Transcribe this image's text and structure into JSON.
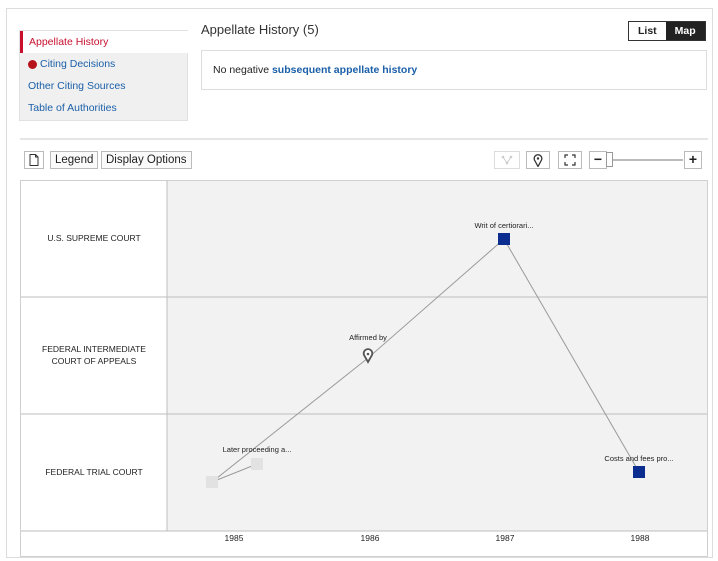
{
  "nav": {
    "items": [
      {
        "label": "Appellate History",
        "active": true
      },
      {
        "label": "Citing Decisions",
        "flag": "red"
      },
      {
        "label": "Other Citing Sources"
      },
      {
        "label": "Table of Authorities"
      }
    ]
  },
  "header": {
    "title": "Appellate History (5)",
    "view_list": "List",
    "view_map": "Map"
  },
  "message": {
    "prefix": "No negative ",
    "link": "subsequent appellate history"
  },
  "toolbar": {
    "legend": "Legend",
    "display_options": "Display Options",
    "zoom_minus": "−",
    "zoom_plus": "+"
  },
  "map": {
    "courts": [
      "U.S. SUPREME COURT",
      "FEDERAL INTERMEDIATE COURT OF APPEALS",
      "FEDERAL TRIAL COURT"
    ],
    "years": [
      "1985",
      "1986",
      "1987",
      "1988"
    ],
    "nodes": [
      {
        "label": "Later proceeding a...",
        "year": "1985",
        "court": "FEDERAL TRIAL COURT"
      },
      {
        "label": "Affirmed by",
        "year": "1986",
        "court": "FEDERAL INTERMEDIATE COURT OF APPEALS"
      },
      {
        "label": "Writ of certiorari...",
        "year": "1987",
        "court": "U.S. SUPREME COURT"
      },
      {
        "label": "Costs and fees pro...",
        "year": "1988",
        "court": "FEDERAL TRIAL COURT"
      }
    ],
    "colors": {
      "node_active": "#0a2d8f",
      "node_muted": "#e2e2e2",
      "grid_bg": "#f2f2f2",
      "line": "#9a9a9a"
    }
  }
}
